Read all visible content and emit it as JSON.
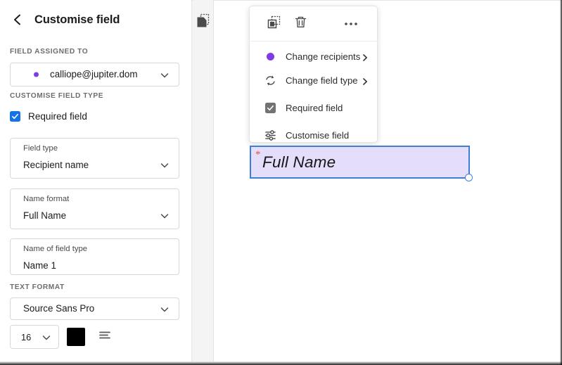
{
  "panel": {
    "title": "Customise field",
    "back_icon": "chevron-left-icon",
    "sections": {
      "field_assigned_to": {
        "label": "FIELD ASSIGNED TO",
        "recipient": {
          "value": "calliope@jupiter.dom",
          "dot_color": "#7d3ce6",
          "chevron": "chevron-down-icon"
        }
      },
      "customise_field_type": {
        "label": "CUSTOMISE FIELD TYPE",
        "required_field": {
          "label": "Required field",
          "checked": true,
          "accent": "#1473e6"
        },
        "field_type": {
          "label": "Field type",
          "value": "Recipient name"
        },
        "name_format": {
          "label": "Name format",
          "value": "Full Name"
        },
        "name_of_field_type": {
          "label": "Name of field type",
          "value": "Name 1"
        }
      },
      "text_format": {
        "label": "TEXT FORMAT",
        "font": {
          "value": "Source Sans Pro"
        },
        "font_size": {
          "value": "16"
        },
        "color": {
          "value": "#000000"
        },
        "alignment": {
          "value": "align-left"
        }
      }
    }
  },
  "strip": {
    "duplicate_pages_icon": "duplicate-pages-icon"
  },
  "context_menu": {
    "toolbar": [
      {
        "icon": "duplicate-field-icon",
        "name": "duplicate-field-button"
      },
      {
        "icon": "trash-icon",
        "name": "delete-field-button"
      },
      {
        "icon": "more-options-icon",
        "name": "more-options-button"
      }
    ],
    "items": [
      {
        "label": "Change recipients",
        "icon": "recipient-dot-icon",
        "submenu": true,
        "arrow": "chevron-right-icon"
      },
      {
        "label": "Change field type",
        "icon": "sync-arrows-icon",
        "submenu": true,
        "arrow": "chevron-right-icon"
      },
      {
        "label": "Required field",
        "icon": "checkbox-checked-icon",
        "submenu": false,
        "checked": true
      },
      {
        "label": "Customise field",
        "icon": "sliders-icon",
        "submenu": false
      }
    ]
  },
  "canvas": {
    "form_field": {
      "text": "Full Name",
      "required_marker": "*",
      "selected": true,
      "fill_color": "#e4defa",
      "border_color": "#3d7edb",
      "marker_color": "#e8563f"
    }
  }
}
